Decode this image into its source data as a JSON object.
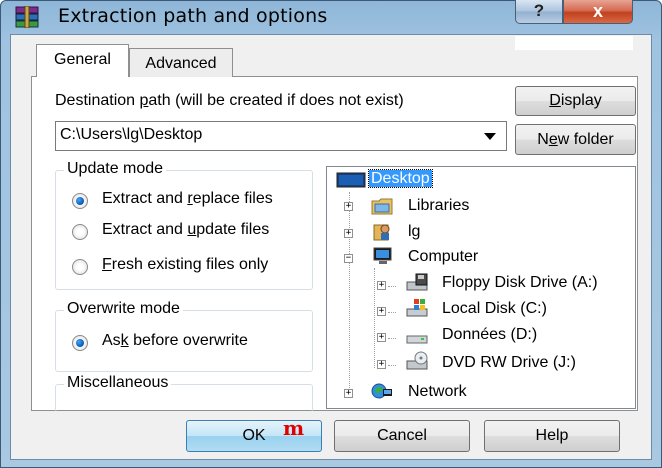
{
  "window": {
    "title": "Extraction path and options",
    "help_glyph": "?",
    "close_glyph": "x",
    "app_icon": "winrar-books-icon"
  },
  "tabs": [
    {
      "label": "General",
      "selected": true
    },
    {
      "label": "Advanced",
      "selected": false
    }
  ],
  "destination": {
    "label_before": "Destination ",
    "label_accel": "p",
    "label_after": "ath (will be created if does not exist)",
    "value": "C:\\Users\\lg\\Desktop"
  },
  "buttons": {
    "display_accel": "D",
    "display_rest": "isplay",
    "newfolder_before": "N",
    "newfolder_accel": "e",
    "newfolder_after": "w folder",
    "ok": "OK",
    "cancel": "Cancel",
    "help": "Help"
  },
  "update_mode": {
    "title": "Update mode",
    "options": [
      {
        "before": "Extract and ",
        "accel": "r",
        "after": "eplace files",
        "checked": true
      },
      {
        "before": "Extract and ",
        "accel": "u",
        "after": "pdate files",
        "checked": false
      },
      {
        "before": "",
        "accel": "F",
        "after": "resh existing files only",
        "checked": false
      }
    ]
  },
  "overwrite_mode": {
    "title": "Overwrite mode",
    "options": [
      {
        "before": "As",
        "accel": "k",
        "after": " before overwrite",
        "checked": true
      }
    ]
  },
  "miscellaneous": {
    "title": "Miscellaneous"
  },
  "tree": {
    "items": [
      {
        "label": "Desktop",
        "icon": "desktop-icon",
        "selected": true
      },
      {
        "label": "Libraries",
        "icon": "libraries-folder-icon"
      },
      {
        "label": "lg",
        "icon": "user-icon"
      },
      {
        "label": "Computer",
        "icon": "computer-icon"
      },
      {
        "label": "Floppy Disk Drive (A:)",
        "icon": "floppy-drive-icon"
      },
      {
        "label": "Local Disk (C:)",
        "icon": "local-disk-icon"
      },
      {
        "label": "Données (D:)",
        "icon": "hard-drive-icon"
      },
      {
        "label": "DVD RW Drive (J:)",
        "icon": "dvd-drive-icon"
      },
      {
        "label": "Network",
        "icon": "network-icon"
      }
    ]
  },
  "ok_badge": "m",
  "colors": {
    "selection": "#3399ff",
    "close_button": "#c1401f",
    "title_gradient": "#9fc3e0"
  }
}
